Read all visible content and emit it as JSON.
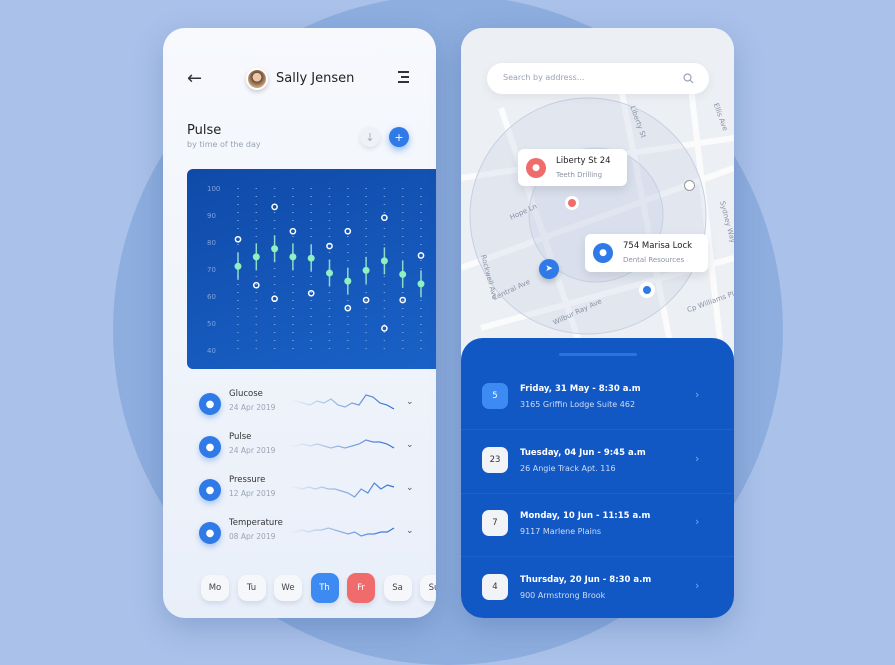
{
  "header": {
    "user_name": "Sally Jensen"
  },
  "section": {
    "title": "Pulse",
    "subtitle": "by time of the day"
  },
  "chart_data": {
    "type": "scatter",
    "title": "",
    "y_ticks": [
      "100",
      "90",
      "80",
      "70",
      "60",
      "50",
      "40"
    ],
    "ylim": [
      40,
      100
    ],
    "grid": "dotted vertical",
    "averages": [
      71,
      74.5,
      77.5,
      74.5,
      74,
      68.5,
      65.5,
      69.5,
      73,
      68,
      64.5
    ],
    "extremes": [
      [
        81
      ],
      [
        64
      ],
      [
        93,
        59
      ],
      [
        84
      ],
      [
        61
      ],
      [
        78.5
      ],
      [
        84,
        55.5
      ],
      [
        58.5
      ],
      [
        89,
        48
      ],
      [
        58.5
      ],
      [
        75
      ]
    ]
  },
  "metrics": [
    {
      "name": "Glucose",
      "date": "24 Apr 2019",
      "icon": "drop-icon",
      "spark": [
        5,
        6,
        5,
        4,
        6,
        5,
        7,
        4,
        3,
        5,
        4,
        9,
        8,
        5,
        4,
        2
      ]
    },
    {
      "name": "Pulse",
      "date": "24 Apr 2019",
      "icon": "heart-icon",
      "spark": [
        5,
        5,
        6,
        5,
        6,
        5,
        4,
        5,
        4,
        5,
        6,
        8,
        7,
        7,
        6,
        4
      ]
    },
    {
      "name": "Pressure",
      "date": "12 Apr 2019",
      "icon": "gauge-icon",
      "spark": [
        5,
        6,
        5,
        6,
        5,
        6,
        5,
        5,
        4,
        3,
        1,
        5,
        3,
        8,
        5,
        7,
        6
      ]
    },
    {
      "name": "Temperature",
      "date": "08 Apr 2019",
      "icon": "thermometer-icon",
      "spark": [
        5,
        5,
        6,
        5,
        6,
        6,
        7,
        6,
        5,
        4,
        5,
        3,
        4,
        4,
        5,
        5,
        7
      ]
    }
  ],
  "days": [
    "Mo",
    "Tu",
    "We",
    "Th",
    "Fr",
    "Sa",
    "Su"
  ],
  "colors": {
    "primary": "#2f7ae6",
    "accent_red": "#f06c6c",
    "panel": "#1258c5",
    "green": "#8ff0c0"
  },
  "search": {
    "placeholder": "Search by address..."
  },
  "map": {
    "streets": [
      "Liberty St",
      "Ellis Ave",
      "Hope Ln",
      "Sydney Way",
      "Rockwell Ave",
      "Central Ave",
      "Wilbur Ray Ave",
      "Cp Williams Pl"
    ],
    "places": [
      {
        "name": "Liberty St 24",
        "type": "Teeth Drilling",
        "icon": "tooth-icon"
      },
      {
        "name": "754 Marisa Lock",
        "type": "Dental Resources",
        "icon": "people-icon"
      }
    ]
  },
  "appointments": [
    {
      "day": "5",
      "title": "Friday, 31 May - 8:30 a.m",
      "address": "3165 Griffin Lodge Suite 462",
      "active": true
    },
    {
      "day": "23",
      "title": "Tuesday, 04 Jun - 9:45 a.m",
      "address": "26 Angie Track Apt. 116"
    },
    {
      "day": "7",
      "title": "Monday, 10 Jun - 11:15 a.m",
      "address": "9117 Marlene Plains"
    },
    {
      "day": "4",
      "title": "Thursday, 20 Jun - 8:30 a.m",
      "address": "900 Armstrong Brook"
    }
  ]
}
